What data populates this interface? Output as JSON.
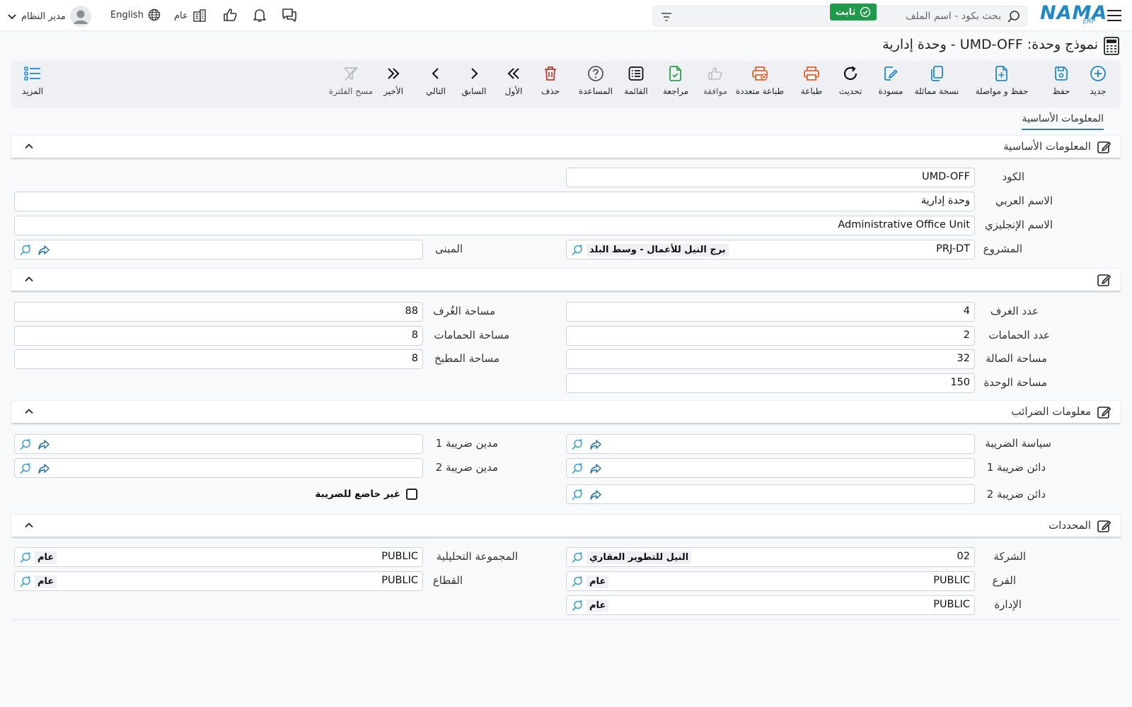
{
  "header": {
    "user_name": "مدير النظام",
    "language": "English",
    "org_label": "عام",
    "search_placeholder": "بحث بكود - اسم الملف",
    "logo_text": "NAMA",
    "logo_sub": "ERP"
  },
  "page": {
    "title": "نموذج وحدة: UMD-OFF - وحدة إدارية",
    "status": "ثابت"
  },
  "toolbar": {
    "new": "جديد",
    "save": "حفظ",
    "save_continue": "حفظ و مواصلة",
    "duplicate": "نسخة مماثلة",
    "draft": "مسودة",
    "refresh": "تحديث",
    "print": "طباعة",
    "multi_print": "طباعة متعددة",
    "approve": "موافقة",
    "review": "مراجعة",
    "list": "القائمة",
    "help": "المساعدة",
    "delete": "حذف",
    "first": "الأول",
    "previous": "السابق",
    "next": "التالي",
    "last": "الأخير",
    "clear_filter": "مسح الفلترة",
    "more": "المزيد"
  },
  "tabs": {
    "basic": "المعلومات الأساسية"
  },
  "basic_info": {
    "title": "المعلومات الأساسية",
    "code_label": "الكود",
    "code_value": "UMD-OFF",
    "arabic_name_label": "الاسم العربي",
    "arabic_name_value": "وحدة إدارية",
    "english_name_label": "الاسم الإنجليزي",
    "english_name_value": "Administrative Office Unit",
    "project_label": "المشروع",
    "project_code": "PRJ-DT",
    "project_name": "برج النيل للأعمال - وسط البلد",
    "building_label": "المبنى"
  },
  "areas": {
    "rooms_count_label": "عدد الغرف",
    "rooms_count": "4",
    "rooms_area_label": "مساحة الغُرف",
    "rooms_area": "88",
    "bathrooms_count_label": "عدد الحمامات",
    "bathrooms_count": "2",
    "bathrooms_area_label": "مساحة الحمامات",
    "bathrooms_area": "8",
    "hall_area_label": "مساحة الصالة",
    "hall_area": "32",
    "kitchen_area_label": "مساحة المطبخ",
    "kitchen_area": "8",
    "unit_area_label": "مساحة الوحدة",
    "unit_area": "150"
  },
  "tax": {
    "title": "معلومات الضرائب",
    "policy_label": "سياسة الضريبة",
    "debtor1_label": "مدين ضريبة 1",
    "creditor1_label": "دائن ضريبة 1",
    "debtor2_label": "مدين ضريبة 2",
    "creditor2_label": "دائن ضريبة 2",
    "not_taxable_label": "غير خاضع للضريبة"
  },
  "dimensions": {
    "title": "المحددات",
    "company_label": "الشركة",
    "company_code": "02",
    "company_name": "النيل للتطوير العقاري",
    "analytic_group_label": "المجموعة التحليلية",
    "analytic_group_code": "PUBLIC",
    "analytic_group_name": "عام",
    "branch_label": "الفرع",
    "branch_code": "PUBLIC",
    "branch_name": "عام",
    "sector_label": "القطاع",
    "sector_code": "PUBLIC",
    "sector_name": "عام",
    "department_label": "الإدارة",
    "department_code": "PUBLIC",
    "department_name": "عام"
  }
}
